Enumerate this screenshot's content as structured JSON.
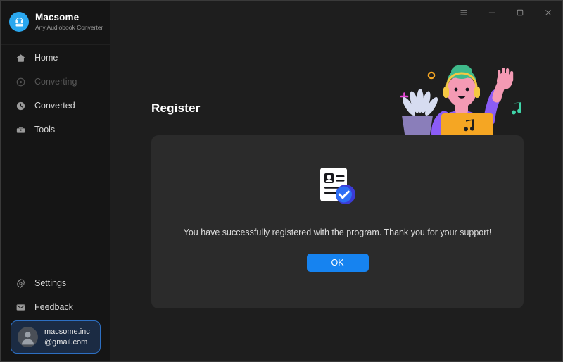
{
  "window": {
    "controls": [
      {
        "name": "menu",
        "glyph": "hamburger-icon"
      },
      {
        "name": "minimize",
        "glyph": "minimize-icon"
      },
      {
        "name": "maximize",
        "glyph": "maximize-icon"
      },
      {
        "name": "close",
        "glyph": "close-icon"
      }
    ]
  },
  "sidebar": {
    "brand": {
      "title": "Macsome",
      "subtitle": "Any Audiobook Converter",
      "logo_color": "#2aa7ef"
    },
    "items": [
      {
        "label": "Home",
        "icon": "home-icon",
        "state": "active"
      },
      {
        "label": "Converting",
        "icon": "converting-icon",
        "state": "disabled"
      },
      {
        "label": "Converted",
        "icon": "clock-icon",
        "state": "normal"
      },
      {
        "label": "Tools",
        "icon": "toolbox-icon",
        "state": "normal"
      }
    ],
    "bottom_items": [
      {
        "label": "Settings",
        "icon": "gear-icon"
      },
      {
        "label": "Feedback",
        "icon": "envelope-icon"
      }
    ],
    "account": {
      "email_line1": "macsome.inc",
      "email_line2": "@gmail.com",
      "avatar_icon": "user-avatar-icon",
      "border_color": "#2d6fc2",
      "background_color": "#1b2b43"
    }
  },
  "main": {
    "page_title": "Register",
    "card": {
      "icon": "registered-document-check-icon",
      "message": "You have successfully registered with the program. Thank you for your support!",
      "ok_label": "OK",
      "ok_color": "#1683f0",
      "background_color": "#2b2b2b"
    },
    "illustration": {
      "name": "person-with-laptop-illustration",
      "colors": {
        "hat": "#3fb98a",
        "shirt": "#8b5cf6",
        "skin": "#f49ab4",
        "laptop": "#f5a623",
        "plant": "#d6dcf0",
        "plus": "#e94ad9",
        "dot": "#f5a623",
        "music_note": "#3fd4a8"
      }
    }
  },
  "theme": {
    "app_background": "#1e1e1e",
    "sidebar_background": "#151515",
    "accent": "#1683f0",
    "text_primary": "#ffffff",
    "text_secondary": "#9a9a9a"
  }
}
